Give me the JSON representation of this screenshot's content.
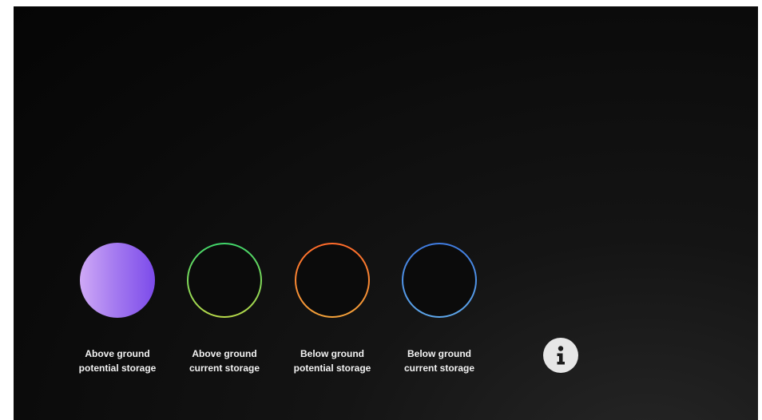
{
  "legend": {
    "items": [
      {
        "line1": "Above ground",
        "line2": "potential storage",
        "style": "filled",
        "colors": [
          "#cfa9f6",
          "#7c4bea"
        ]
      },
      {
        "line1": "Above ground",
        "line2": "current storage",
        "style": "ring",
        "colors": [
          "#3fd56a",
          "#b8d94a"
        ]
      },
      {
        "line1": "Below ground",
        "line2": "potential storage",
        "style": "ring",
        "colors": [
          "#ff6a2a",
          "#f3a23a"
        ]
      },
      {
        "line1": "Below ground",
        "line2": "current storage",
        "style": "ring",
        "colors": [
          "#3f7be0",
          "#5ea7ea"
        ]
      }
    ]
  },
  "info": {
    "icon": "info-icon",
    "color": "#e6e6e6"
  },
  "theme": {
    "background": "#0b0b0b",
    "text": "#f2f2f2"
  }
}
